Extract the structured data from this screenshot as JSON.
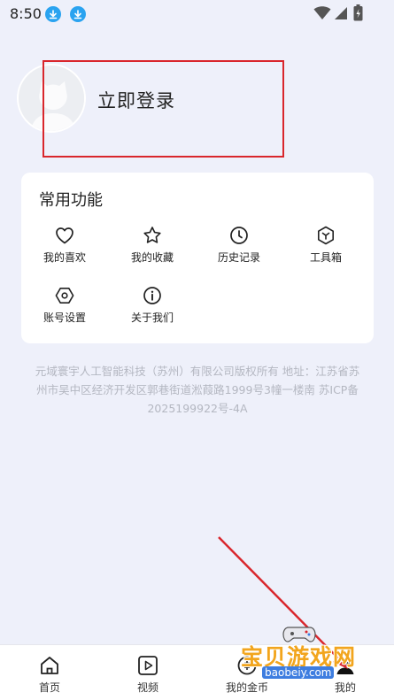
{
  "status_bar": {
    "time": "8:50",
    "icons": [
      "download-icon",
      "download-icon",
      "wifi-icon",
      "signal-icon",
      "battery-icon"
    ]
  },
  "profile": {
    "login_label": "立即登录",
    "avatar_icon": "avatar-placeholder-icon"
  },
  "functions": {
    "title": "常用功能",
    "items": [
      {
        "label": "我的喜欢",
        "icon": "heart-icon"
      },
      {
        "label": "我的收藏",
        "icon": "star-icon"
      },
      {
        "label": "历史记录",
        "icon": "clock-icon"
      },
      {
        "label": "工具箱",
        "icon": "toolbox-icon"
      },
      {
        "label": "账号设置",
        "icon": "settings-icon"
      },
      {
        "label": "关于我们",
        "icon": "info-icon"
      }
    ]
  },
  "legal": {
    "line1": "元域寰宇人工智能科技（苏州）有限公司版权所有 地址：江苏省苏",
    "line2": "州市吴中区经济开发区郭巷街道淞葭路1999号3幢一楼南 苏ICP备",
    "line3": "2025199922号-4A"
  },
  "bottom_nav": {
    "items": [
      {
        "label": "首页",
        "icon": "home-icon"
      },
      {
        "label": "视频",
        "icon": "video-icon"
      },
      {
        "label": "我的金币",
        "icon": "coin-icon"
      },
      {
        "label": "我的",
        "icon": "profile-icon"
      }
    ]
  },
  "watermark": {
    "title": "宝贝游戏网",
    "url": "baobeiy.com"
  },
  "colors": {
    "background": "#eef0fa",
    "accent_blue": "#2aa3f0",
    "annotation_red": "#d9262c",
    "legal_text": "#b4b7c1"
  }
}
